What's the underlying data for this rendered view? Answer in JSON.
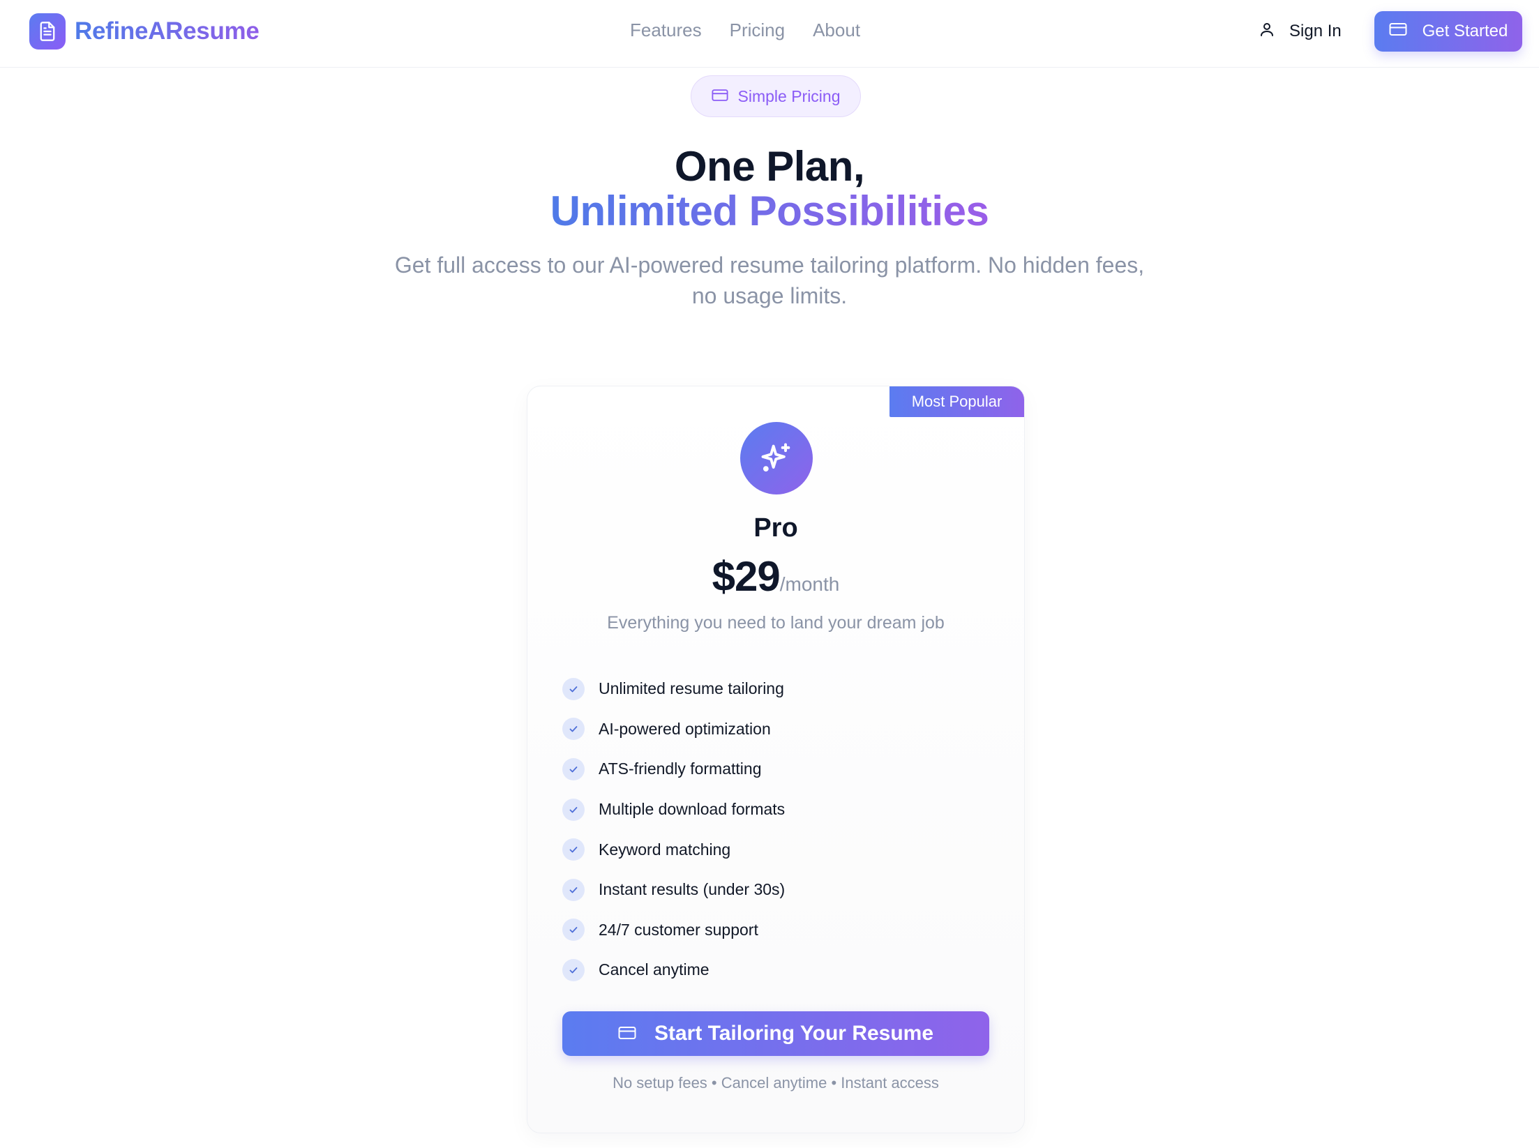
{
  "header": {
    "brand": "RefineAResume",
    "nav": [
      {
        "label": "Features"
      },
      {
        "label": "Pricing"
      },
      {
        "label": "About"
      }
    ],
    "sign_in": "Sign In",
    "get_started": "Get Started"
  },
  "hero": {
    "pill": "Simple Pricing",
    "title_line1": "One Plan,",
    "title_line2": "Unlimited Possibilities",
    "subtitle": "Get full access to our AI-powered resume tailoring platform. No hidden fees, no usage limits."
  },
  "plan": {
    "badge": "Most Popular",
    "name": "Pro",
    "price": "$29",
    "period": "/month",
    "tagline": "Everything you need to land your dream job",
    "features": [
      {
        "label": "Unlimited resume tailoring"
      },
      {
        "label": "AI-powered optimization"
      },
      {
        "label": "ATS-friendly formatting"
      },
      {
        "label": "Multiple download formats"
      },
      {
        "label": "Keyword matching"
      },
      {
        "label": "Instant results (under 30s)"
      },
      {
        "label": "24/7 customer support"
      },
      {
        "label": "Cancel anytime"
      }
    ],
    "cta": "Start Tailoring Your Resume",
    "footnote": "No setup fees • Cancel anytime • Instant access"
  },
  "colors": {
    "accent_start": "#5b7cf0",
    "accent_end": "#8f63ea",
    "muted_text": "#8a93a6",
    "heading": "#0f172a"
  }
}
